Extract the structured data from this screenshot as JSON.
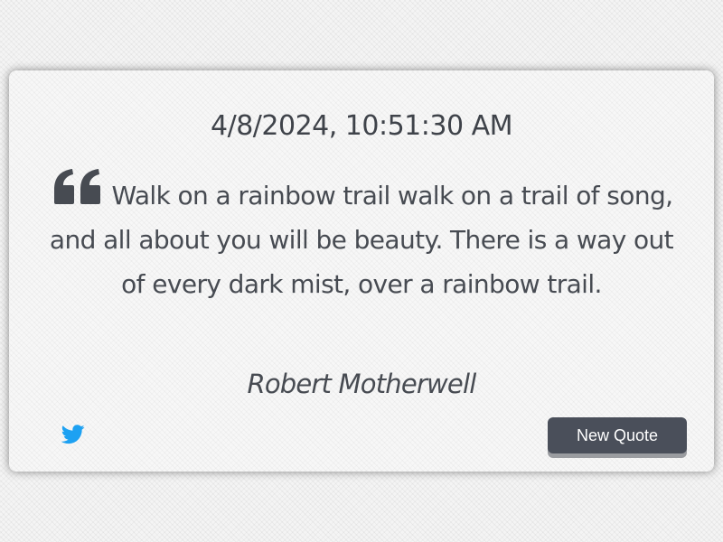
{
  "timestamp": "4/8/2024, 10:51:30 AM",
  "quote": {
    "text": "Walk on a rainbow trail walk on a trail of song, and all about you will be beauty. There is a way out of every dark mist, over a rainbow trail.",
    "author": "Robert Motherwell",
    "icon": "quote-left-icon"
  },
  "actions": {
    "tweet_icon": "twitter-icon",
    "new_quote_label": "New Quote"
  },
  "colors": {
    "text": "#474b52",
    "button": "#4a4f5a",
    "twitter": "#1da1f2"
  }
}
